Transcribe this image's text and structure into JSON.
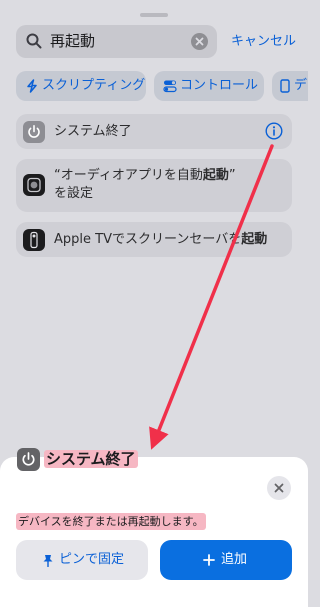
{
  "search": {
    "query": "再起動",
    "cancel_label": "キャンセル"
  },
  "chips": [
    {
      "label": "スクリプティング",
      "icon": "scripting-icon"
    },
    {
      "label": "コントロール",
      "icon": "toggle-icon"
    },
    {
      "label": "デ",
      "icon": "device-icon"
    }
  ],
  "results": [
    {
      "label": "システム終了",
      "icon": "power-icon"
    },
    {
      "label_before": "“オーディオアプリを自動",
      "label_bold": "起動",
      "label_after": "”",
      "line2": "を設定",
      "icon": "watch-icon"
    },
    {
      "label_before": "Apple TVでスクリーンセーバを",
      "label_bold": "起動",
      "icon": "remote-icon"
    }
  ],
  "sheet": {
    "title": "システム終了",
    "description": "デバイスを終了または再起動します。",
    "pin_label": "ピンで固定",
    "add_label": "追加"
  },
  "colors": {
    "accent": "#0a60d6",
    "arrow": "#f0304a",
    "highlight": "#f6b7c3"
  }
}
